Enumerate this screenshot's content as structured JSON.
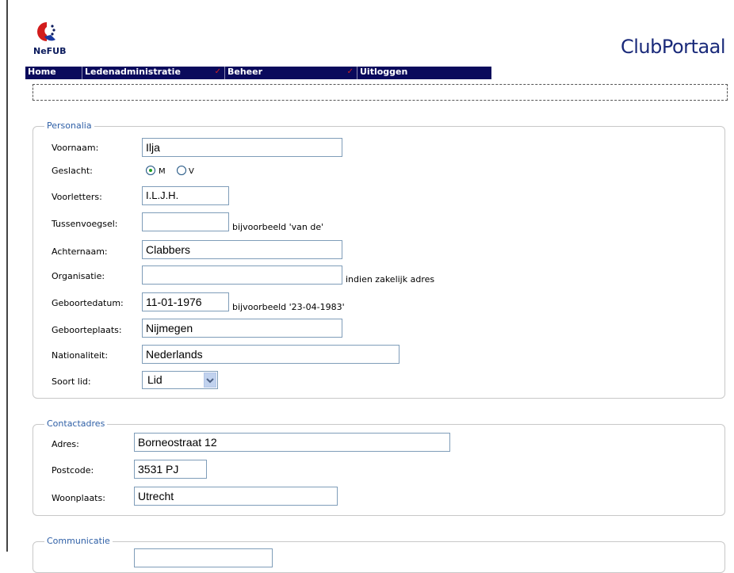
{
  "header": {
    "logo_text": "NeFUB",
    "brand_title": "ClubPortaal"
  },
  "nav": {
    "items": [
      {
        "label": "Home",
        "has_dropdown": false
      },
      {
        "label": "Ledenadministratie",
        "has_dropdown": true
      },
      {
        "label": "Beheer",
        "has_dropdown": true
      },
      {
        "label": "Uitloggen",
        "has_dropdown": false
      }
    ],
    "dropdown_glyph": "✓"
  },
  "personalia": {
    "legend": "Personalia",
    "voornaam": {
      "label": "Voornaam:",
      "value": "Ilja"
    },
    "geslacht": {
      "label": "Geslacht:",
      "options": [
        "M",
        "V"
      ],
      "selected": "M"
    },
    "voorletters": {
      "label": "Voorletters:",
      "value": "I.L.J.H."
    },
    "tussenvoegsel": {
      "label": "Tussenvoegsel:",
      "value": "",
      "hint": "bijvoorbeeld 'van de'"
    },
    "achternaam": {
      "label": "Achternaam:",
      "value": "Clabbers"
    },
    "organisatie": {
      "label": "Organisatie:",
      "value": "",
      "hint": "indien zakelijk adres"
    },
    "geboortedatum": {
      "label": "Geboortedatum:",
      "value": "11-01-1976",
      "hint": "bijvoorbeeld '23-04-1983'"
    },
    "geboorteplaats": {
      "label": "Geboorteplaats:",
      "value": "Nijmegen"
    },
    "nationaliteit": {
      "label": "Nationaliteit:",
      "value": "Nederlands"
    },
    "soort_lid": {
      "label": "Soort lid:",
      "value": "Lid"
    }
  },
  "contactadres": {
    "legend": "Contactadres",
    "adres": {
      "label": "Adres:",
      "value": "Borneostraat 12"
    },
    "postcode": {
      "label": "Postcode:",
      "value": "3531 PJ"
    },
    "woonplaats": {
      "label": "Woonplaats:",
      "value": "Utrecht"
    }
  },
  "communicatie": {
    "legend": "Communicatie"
  },
  "colors": {
    "nav_bg": "#0a0a5c",
    "legend": "#2e5fa6",
    "brand": "#1a2a7a",
    "logo_red": "#d21c1c",
    "logo_navy": "#0a1a5c"
  }
}
